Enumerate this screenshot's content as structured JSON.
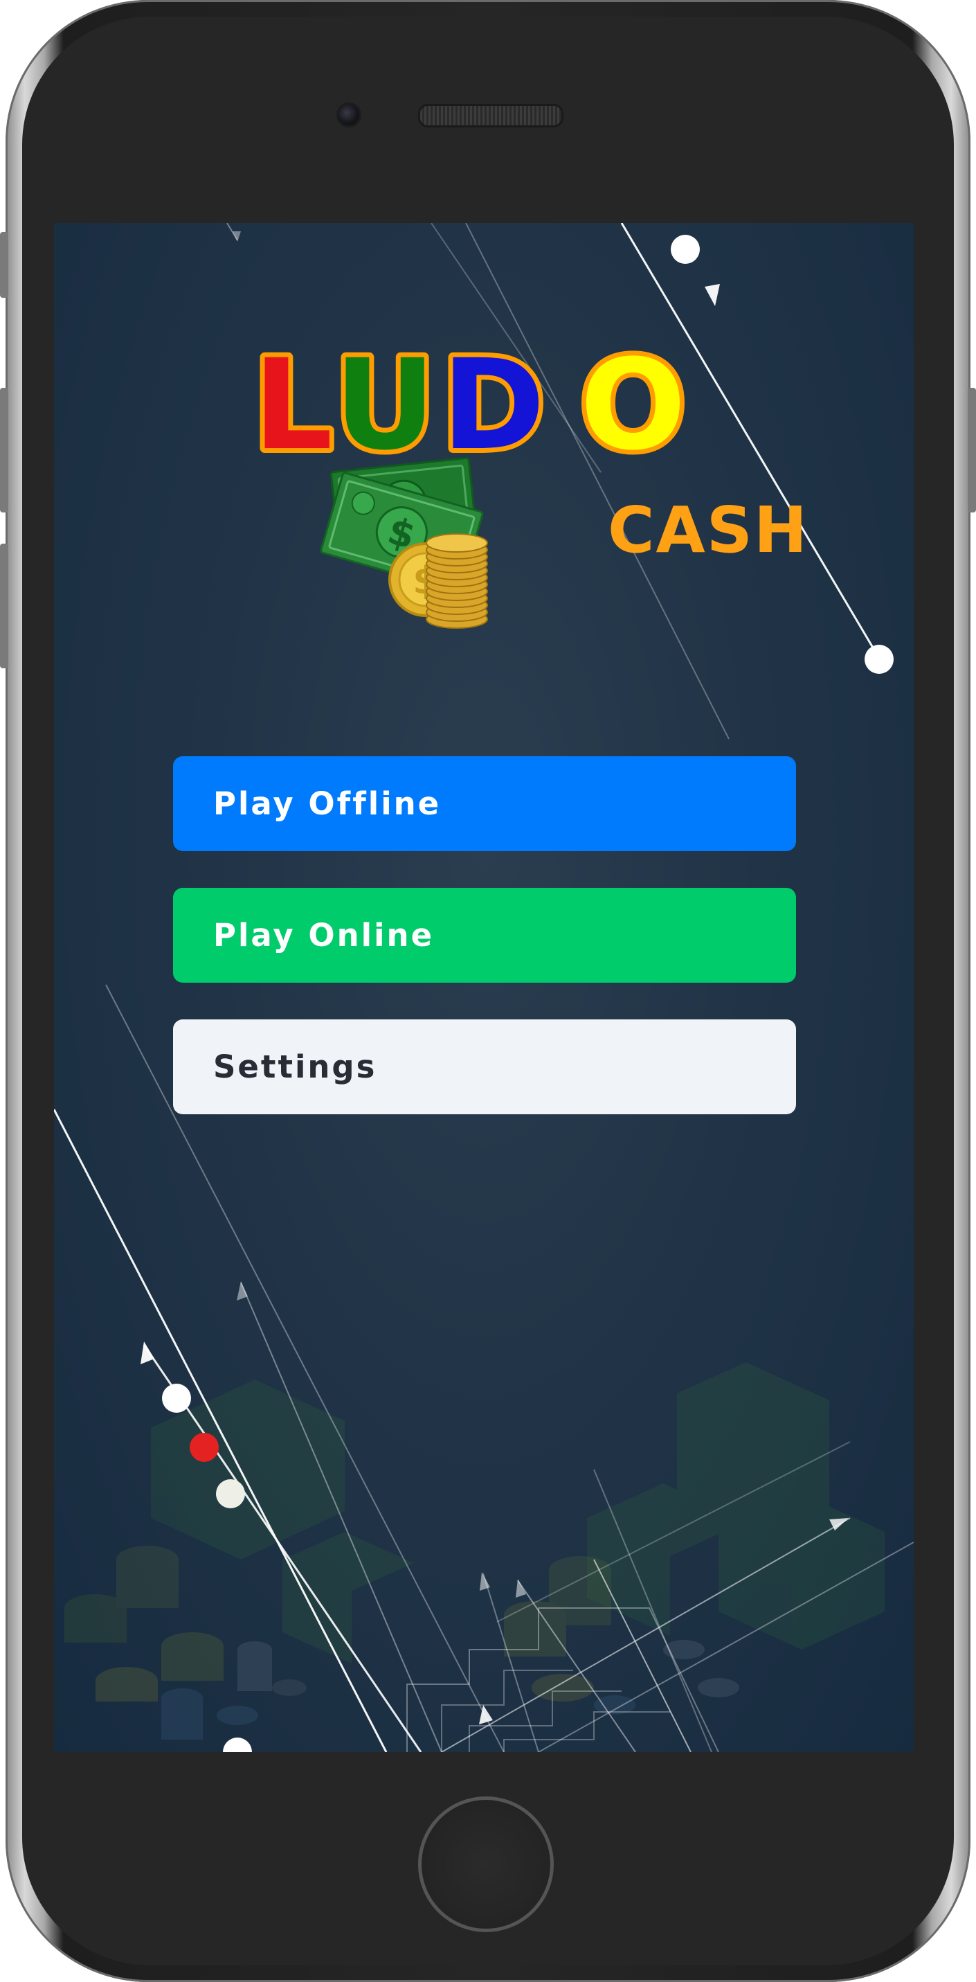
{
  "app": {
    "logo_word": "LUDO",
    "logo_subword": "CASH",
    "logo_letters": [
      {
        "char": "L",
        "color": "#e8141c"
      },
      {
        "char": "U",
        "color": "#0f7f10"
      },
      {
        "char": "D",
        "color": "#1414d6"
      },
      {
        "char": "O",
        "color": "#ffff00"
      }
    ],
    "logo_outline_color": "#ff9d00",
    "subword_color": "#ffa115"
  },
  "menu": {
    "buttons": [
      {
        "label": "Play Offline",
        "bg": "#007bfd",
        "text_color": "#ffffff"
      },
      {
        "label": "Play Online",
        "bg": "#00cc6c",
        "text_color": "#ffffff"
      },
      {
        "label": "Settings",
        "bg": "#f0f3f7",
        "text_color": "#272c35"
      }
    ]
  },
  "theme": {
    "screen_bg": "#1f3346",
    "accent_dot_color": "#e52222"
  },
  "icons": [
    "money-stack-icon",
    "coin-stack-icon",
    "camera-icon",
    "speaker-icon",
    "home-button-icon"
  ]
}
